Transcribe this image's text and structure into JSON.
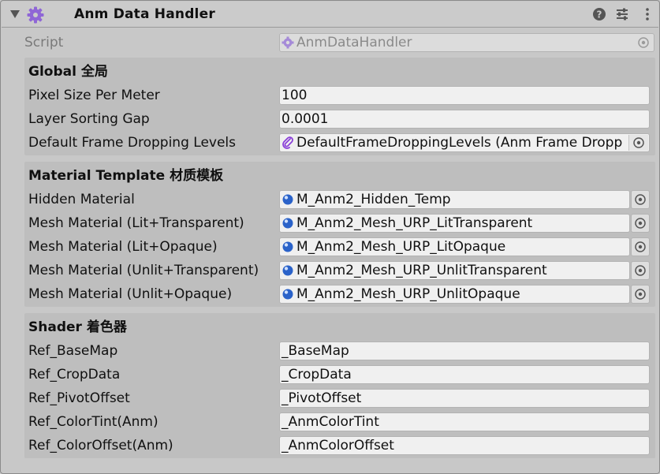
{
  "header": {
    "title": "Anm Data Handler",
    "icons": [
      "foldout-arrow-icon",
      "component-gear-icon",
      "help-icon",
      "presets-icon",
      "more-menu-icon"
    ]
  },
  "script": {
    "label": "Script",
    "value": "AnmDataHandler"
  },
  "global": {
    "title": "Global 全局",
    "pixel_size_label": "Pixel Size Per Meter",
    "pixel_size_value": "100",
    "layer_gap_label": "Layer Sorting Gap",
    "layer_gap_value": "0.0001",
    "dropping_label": "Default Frame Dropping Levels",
    "dropping_value": "DefaultFrameDroppingLevels (Anm Frame Dropp"
  },
  "material": {
    "title": "Material Template 材质模板",
    "rows": [
      {
        "label": "Hidden Material",
        "value": "M_Anm2_Hidden_Temp"
      },
      {
        "label": "Mesh Material (Lit+Transparent)",
        "value": "M_Anm2_Mesh_URP_LitTransparent"
      },
      {
        "label": "Mesh Material (Lit+Opaque)",
        "value": "M_Anm2_Mesh_URP_LitOpaque"
      },
      {
        "label": "Mesh Material (Unlit+Transparent)",
        "value": "M_Anm2_Mesh_URP_UnlitTransparent"
      },
      {
        "label": "Mesh Material (Unlit+Opaque)",
        "value": "M_Anm2_Mesh_URP_UnlitOpaque"
      }
    ]
  },
  "shader": {
    "title": "Shader 着色器",
    "rows": [
      {
        "label": "Ref_BaseMap",
        "value": "_BaseMap"
      },
      {
        "label": "Ref_CropData",
        "value": "_CropData"
      },
      {
        "label": "Ref_PivotOffset",
        "value": "_PivotOffset"
      },
      {
        "label": "Ref_ColorTint(Anm)",
        "value": "_AnmColorTint"
      },
      {
        "label": "Ref_ColorOffset(Anm)",
        "value": "_AnmColorOffset"
      }
    ]
  },
  "colors": {
    "accent_gear": "#8f66d6",
    "material_icon": "#2a62c9",
    "background": "#c8c8c8",
    "section": "#bebebe",
    "field": "#f0f0f0"
  }
}
